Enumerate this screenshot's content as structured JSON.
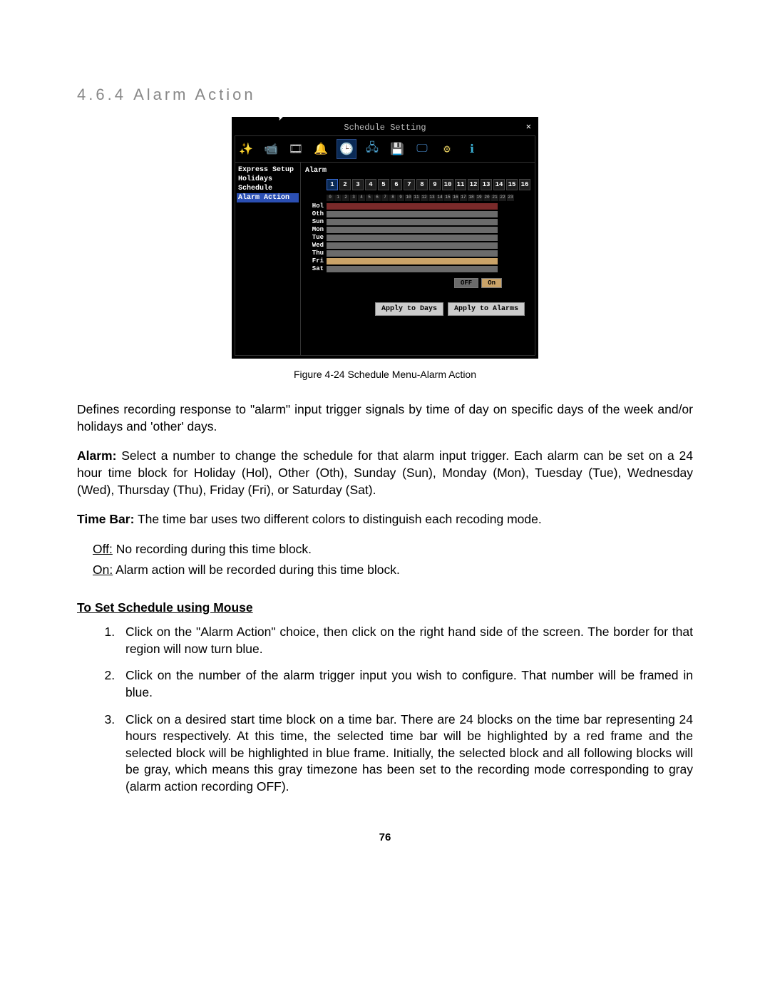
{
  "section": {
    "number": "4.6.4",
    "title": "Alarm Action"
  },
  "figure": {
    "window_title": "Schedule Setting",
    "close": "✕",
    "toolbar_icons": [
      "wand",
      "camera",
      "reel",
      "bell",
      "schedule",
      "network",
      "disk",
      "monitor",
      "gear",
      "info"
    ],
    "sidebar": [
      "Express Setup",
      "Holidays",
      "Schedule",
      "Alarm Action"
    ],
    "sidebar_selected": 3,
    "main_label": "Alarm",
    "alarm_numbers": [
      "1",
      "2",
      "3",
      "4",
      "5",
      "6",
      "7",
      "8",
      "9",
      "10",
      "11",
      "12",
      "13",
      "14",
      "15",
      "16"
    ],
    "selected_alarm": 0,
    "hours": [
      "0",
      "1",
      "2",
      "3",
      "4",
      "5",
      "6",
      "7",
      "8",
      "9",
      "10",
      "11",
      "12",
      "13",
      "14",
      "15",
      "16",
      "17",
      "18",
      "19",
      "20",
      "21",
      "22",
      "23"
    ],
    "day_rows": [
      {
        "label": "Hol",
        "style": "red"
      },
      {
        "label": "Oth",
        "style": "gray"
      },
      {
        "label": "Sun",
        "style": "gray"
      },
      {
        "label": "Mon",
        "style": "gray"
      },
      {
        "label": "Tue",
        "style": "gray"
      },
      {
        "label": "Wed",
        "style": "gray"
      },
      {
        "label": "Thu",
        "style": "gray"
      },
      {
        "label": "Fri",
        "style": "tan"
      },
      {
        "label": "Sat",
        "style": "gray"
      }
    ],
    "legend_off": "OFF",
    "legend_on": "On",
    "apply_days": "Apply to Days",
    "apply_alarms": "Apply to Alarms",
    "caption": "Figure 4-24 Schedule Menu-Alarm Action"
  },
  "body": {
    "intro": "Defines recording response to \"alarm\" input trigger signals by time of day on specific days of the week and/or holidays and 'other' days.",
    "alarm_label": "Alarm:",
    "alarm_text": " Select a number to change the schedule for that alarm input trigger. Each alarm can be set on a 24 hour time block for Holiday (Hol), Other (Oth), Sunday (Sun), Monday (Mon), Tuesday (Tue), Wednesday (Wed), Thursday (Thu), Friday (Fri), or Saturday (Sat).",
    "timebar_label": "Time Bar:",
    "timebar_text": " The time bar uses two different colors to distinguish each recoding mode.",
    "off_label": "Off:",
    "off_text": " No recording during this time block.",
    "on_label": "On:",
    "on_text": " Alarm action will be recorded during this time block.",
    "subhead": "To Set Schedule using Mouse",
    "steps": [
      "Click on the \"Alarm Action\" choice, then click on the right hand side of the screen. The border for that region will now turn blue.",
      "Click on the number of the alarm trigger input you wish to configure.  That number will be framed in blue.",
      "Click on a desired start time block on a time bar. There are 24 blocks on the time bar representing 24 hours respectively. At this time, the selected time bar will be highlighted by a red frame and the selected block will be highlighted in blue frame. Initially, the selected block and all following blocks will be gray, which means this gray timezone has been set to the recording mode corresponding to gray (alarm action recording OFF)."
    ]
  },
  "page_number": "76"
}
